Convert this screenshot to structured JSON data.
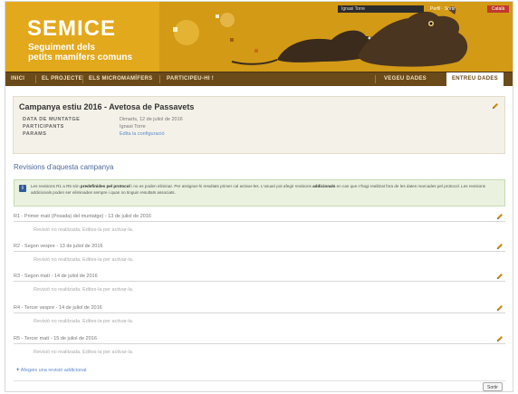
{
  "header": {
    "app_name": "SEMICE",
    "subtitle_line1": "Seguiment dels",
    "subtitle_line2": "petits mamífers comuns",
    "user_name": "Ignasi Torre",
    "top_links": "Perfil · Sortir",
    "badge": "Català",
    "colors": {
      "brand": "#e3a91c",
      "nav": "#6b4a1a"
    }
  },
  "nav": {
    "items": [
      "INICI",
      "EL PROJECTE",
      "ELS MICROMAMÍFERS",
      "PARTICIPEU-HI !",
      "VEGEU DADES",
      "ENTREU DADES"
    ],
    "active": "ENTREU DADES"
  },
  "campaign": {
    "title": "Campanya estiu 2016 - Avetosa de Passavets",
    "fields": [
      {
        "label": "DATA DE MUNTATGE",
        "value": "Dimarts, 12 de juliol de 2016"
      },
      {
        "label": "PARTICIPANTS",
        "value": "Ignasi Torre"
      },
      {
        "label": "PARAMS",
        "value": "Edita la configuració"
      }
    ]
  },
  "revisions": {
    "heading": "Revisions d'aquesta campanya",
    "info_prefix": "Les revisions R1 a R5 són ",
    "info_bold1": "predefinides pel protocol",
    "info_mid": " i no es poden eliminar. Per assignar-hi resultats primer cal activar-les. L'usuari pot afegir revisions ",
    "info_bold2": "addicionals",
    "info_suffix": " en cas que n'hagi realitzat fora de les dates marcades pel protocol. Les revisions addicionals poden ser eliminades sempre i quan no tinguin resultats associats.",
    "items": [
      {
        "title": "R1 - Primer matí (Posada) del muntatge) - 13 de juliol de 2016",
        "note": "Revisió no realitzada. Edites-la per activar-la."
      },
      {
        "title": "R2 - Segon vespre - 13 de juliol de 2016",
        "note": "Revisió no realitzada. Edites-la per activar-la."
      },
      {
        "title": "R3 - Segon matí - 14 de juliol de 2016",
        "note": "Revisió no realitzada. Edites-la per activar-la."
      },
      {
        "title": "R4 - Tercer vespre - 14 de juliol de 2016",
        "note": "Revisió no realitzada. Edites-la per activar-la."
      },
      {
        "title": "R5 - Tercer matí - 15 de juliol de 2016",
        "note": "Revisió no realitzada. Edites-la per activar-la."
      }
    ],
    "add_link": "Afegeix una revisió addicional"
  },
  "footer": {
    "button": "Sortir"
  }
}
